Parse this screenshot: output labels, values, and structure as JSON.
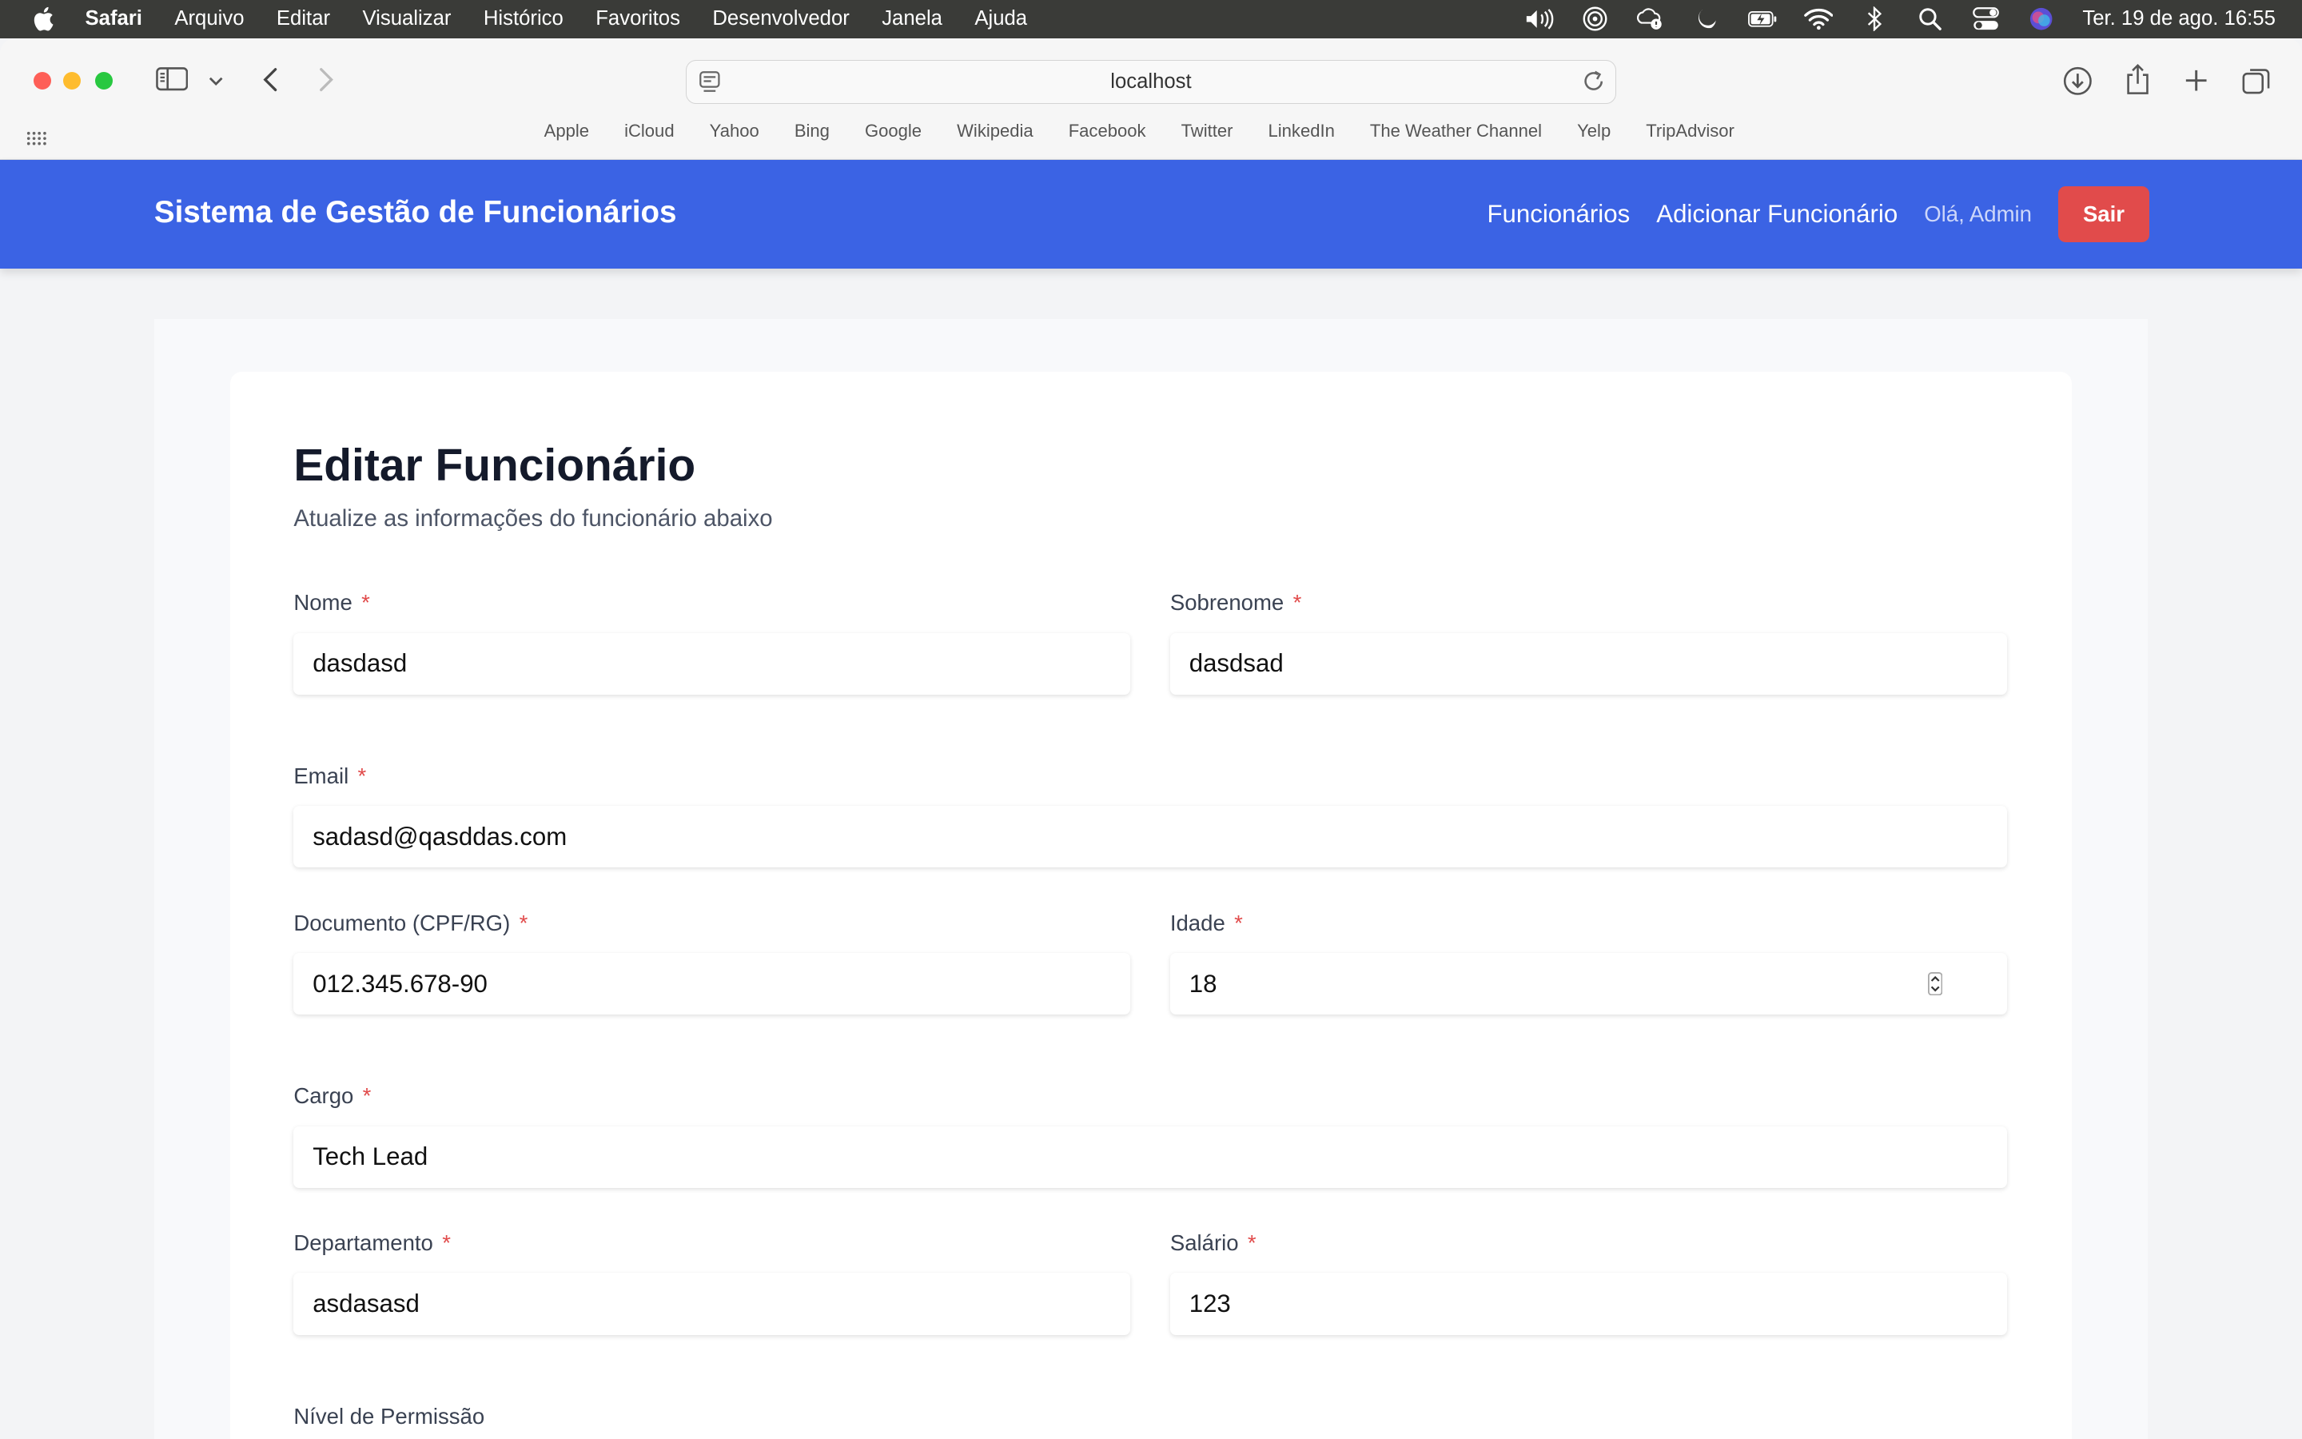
{
  "menubar": {
    "app": "Safari",
    "items": [
      "Arquivo",
      "Editar",
      "Visualizar",
      "Histórico",
      "Favoritos",
      "Desenvolvedor",
      "Janela",
      "Ajuda"
    ],
    "clock": "Ter. 19 de ago.  16:55"
  },
  "browser": {
    "url": "localhost",
    "favorites": [
      "Apple",
      "iCloud",
      "Yahoo",
      "Bing",
      "Google",
      "Wikipedia",
      "Facebook",
      "Twitter",
      "LinkedIn",
      "The Weather Channel",
      "Yelp",
      "TripAdvisor"
    ]
  },
  "navbar": {
    "brand": "Sistema de Gestão de Funcionários",
    "links": [
      "Funcionários",
      "Adicionar Funcionário"
    ],
    "greeting": "Olá, Admin",
    "logout": "Sair",
    "color": "#3b63e4"
  },
  "form": {
    "title": "Editar Funcionário",
    "subtitle": "Atualize as informações do funcionário abaixo",
    "required_mark": "*",
    "fields": {
      "nome": {
        "label": "Nome",
        "value": "dasdasd"
      },
      "sobrenome": {
        "label": "Sobrenome",
        "value": "dasdsad"
      },
      "email": {
        "label": "Email",
        "value": "sadasd@qasddas.com"
      },
      "documento": {
        "label": "Documento (CPF/RG)",
        "value": "012.345.678-90"
      },
      "idade": {
        "label": "Idade",
        "value": "18"
      },
      "cargo": {
        "label": "Cargo",
        "value": "Tech Lead"
      },
      "departamento": {
        "label": "Departamento",
        "value": "asdasasd"
      },
      "salario": {
        "label": "Salário",
        "value": "123"
      },
      "permissao": {
        "label": "Nível de Permissão"
      }
    }
  }
}
